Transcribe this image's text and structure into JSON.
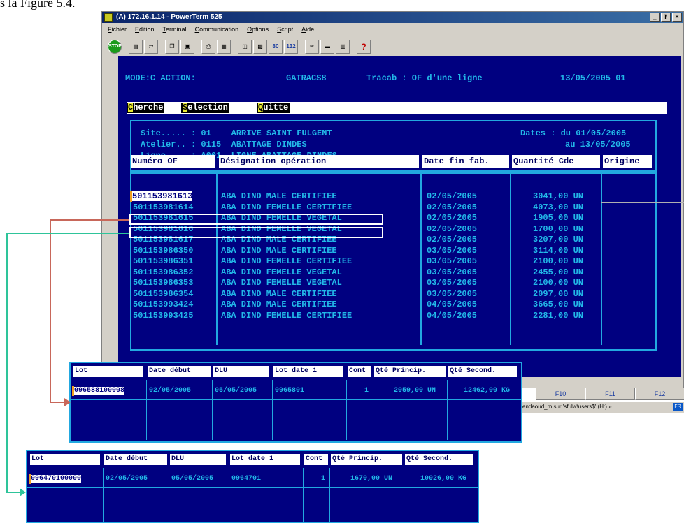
{
  "caption": "s la Figure 5.4.",
  "window": {
    "title": "(A) 172.16.1.14 - PowerTerm 525",
    "controls": [
      "_",
      "ř",
      "×"
    ]
  },
  "menu": [
    "Fichier",
    "Edition",
    "Terminal",
    "Communication",
    "Options",
    "Script",
    "Aide"
  ],
  "toolbar": {
    "stop_label": "STOP",
    "cols80": "80",
    "cols132": "132",
    "help": "?"
  },
  "terminal": {
    "mode": "MODE:C ACTION:",
    "program": "GATRACS8",
    "screen_title": "Tracab : OF d'une ligne",
    "date": "13/05/2005 01",
    "actions": {
      "search_key": "C",
      "search_rest": "herche",
      "select_key": "S",
      "select_rest": "election",
      "quit_key": "Q",
      "quit_rest": "uitte"
    },
    "site_line": "Site..... : 01    ARRIVE SAINT FULGENT",
    "atelier_line": "Atelier.. : 0115  ABATTAGE DINDES",
    "ligne_line": "Ligne.... : A001  LIGNE ABATTAGE DINDES",
    "dates_line1": "Dates : du 01/05/2005",
    "dates_line2": "au 13/05/2005",
    "columns": [
      "Numéro OF",
      "Désignation opération",
      "Date fin fab.",
      "Quantité Cde",
      "Origine"
    ],
    "rows": [
      {
        "of": "501153981613",
        "des": "ABA DIND MALE CERTIFIEE",
        "date": "02/05/2005",
        "qty": "3041,00 UN"
      },
      {
        "of": "501153981614",
        "des": "ABA DIND FEMELLE CERTIFIEE",
        "date": "02/05/2005",
        "qty": "4073,00 UN"
      },
      {
        "of": "501153981615",
        "des": "ABA DIND FEMELLE VEGETAL",
        "date": "02/05/2005",
        "qty": "1905,00 UN"
      },
      {
        "of": "501153981616",
        "des": "ABA DIND FEMELLE VEGETAL",
        "date": "02/05/2005",
        "qty": "1700,00 UN"
      },
      {
        "of": "501153981617",
        "des": "ABA DIND MALE CERTIFIEE",
        "date": "02/05/2005",
        "qty": "3207,00 UN"
      },
      {
        "of": "501153986350",
        "des": "ABA DIND MALE CERTIFIEE",
        "date": "03/05/2005",
        "qty": "3114,00 UN"
      },
      {
        "of": "501153986351",
        "des": "ABA DIND FEMELLE CERTIFIEE",
        "date": "03/05/2005",
        "qty": "2100,00 UN"
      },
      {
        "of": "501153986352",
        "des": "ABA DIND FEMELLE VEGETAL",
        "date": "03/05/2005",
        "qty": "2455,00 UN"
      },
      {
        "of": "501153986353",
        "des": "ABA DIND FEMELLE VEGETAL",
        "date": "03/05/2005",
        "qty": "2100,00 UN"
      },
      {
        "of": "501153986354",
        "des": "ABA DIND MALE CERTIFIEE",
        "date": "03/05/2005",
        "qty": "2097,00 UN"
      },
      {
        "of": "501153993424",
        "des": "ABA DIND MALE CERTIFIEE",
        "date": "04/05/2005",
        "qty": "3665,00 UN"
      },
      {
        "of": "501153993425",
        "des": "ABA DIND FEMELLE CERTIFIEE",
        "date": "04/05/2005",
        "qty": "2281,00 UN"
      }
    ]
  },
  "fkeys": [
    "F10",
    "F11",
    "F12"
  ],
  "taskbar_text": "endaoud_m sur 'sfulw\\users$' (H:) »",
  "taskbar_tray": "FR",
  "popup1": {
    "columns": [
      "Lot",
      "Date début",
      "DLU",
      "Lot date 1",
      "Cont",
      "Qté Princip.",
      "Qté Second."
    ],
    "row": {
      "lot": "096588100008",
      "date": "02/05/2005",
      "dlu": "05/05/2005",
      "lotdate": "0965801",
      "cont": "1",
      "qp": "2059,00 UN",
      "qs": "12462,00 KG"
    }
  },
  "popup2": {
    "columns": [
      "Lot",
      "Date début",
      "DLU",
      "Lot date 1",
      "Cont",
      "Qté Princip.",
      "Qté Second."
    ],
    "row": {
      "lot": "096470100000",
      "date": "02/05/2005",
      "dlu": "05/05/2005",
      "lotdate": "0964701",
      "cont": "1",
      "qp": "1670,00 UN",
      "qs": "10026,00 KG"
    }
  },
  "colors": {
    "terminal_bg": "#000080",
    "terminal_text": "#22b8e8",
    "arrow_red": "#c8675a",
    "arrow_green": "#2ec49a"
  }
}
